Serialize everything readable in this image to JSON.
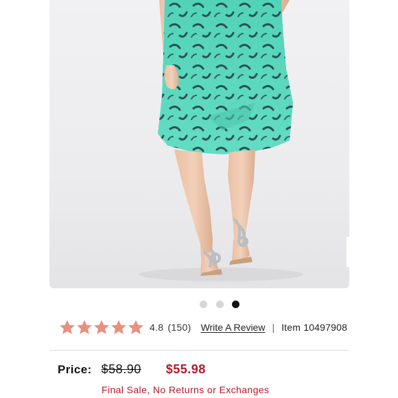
{
  "product_image": {
    "alt_subject": "teal skirt with feather print and embellished sandals"
  },
  "carousel": {
    "total": 3,
    "active_index": 2
  },
  "rating": {
    "stars_filled": 5,
    "score": "4.8",
    "count": "(150)",
    "write_review_label": "Write A Review",
    "separator": "|",
    "item_number": "Item 10497908"
  },
  "pricing": {
    "label": "Price:",
    "original_price": "$58.90",
    "sale_price": "$55.98",
    "final_sale_note": "Final Sale, No Returns or Exchanges"
  },
  "colors": {
    "star": "#e8907f",
    "sale_red": "#b3182a",
    "skirt_teal": "#5fd9bf"
  }
}
